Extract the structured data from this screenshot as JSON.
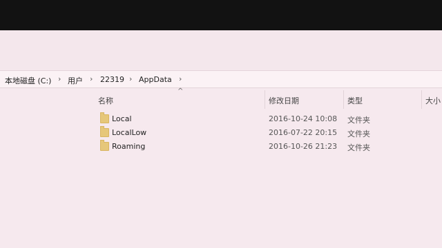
{
  "breadcrumb": {
    "items": [
      "本地磁盘 (C:)",
      "用户",
      "22319",
      "AppData"
    ],
    "separator": "›"
  },
  "columns": {
    "name": "名称",
    "modified": "修改日期",
    "type": "类型",
    "size": "大小"
  },
  "sort_indicator": "^",
  "rows": [
    {
      "name": "Local",
      "modified": "2016-10-24 10:08",
      "type": "文件夹"
    },
    {
      "name": "LocalLow",
      "modified": "2016-07-22 20:15",
      "type": "文件夹"
    },
    {
      "name": "Roaming",
      "modified": "2016-10-26 21:23",
      "type": "文件夹"
    }
  ],
  "colors": {
    "background": "#f6e9ee",
    "top_dark": "#121212",
    "folder": "#e6c77a"
  },
  "icons": {
    "folder": "folder-icon",
    "chevron": "chevron-right-icon",
    "sort": "sort-up-icon"
  }
}
